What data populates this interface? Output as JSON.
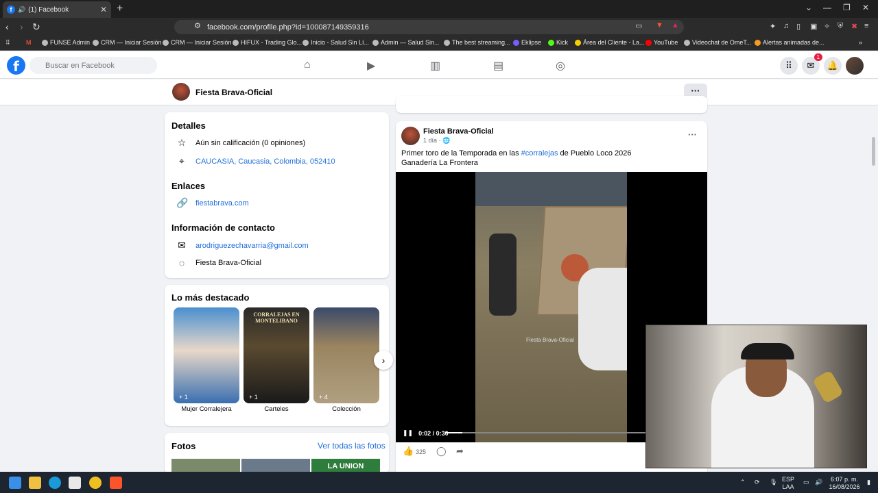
{
  "browser": {
    "tab_title": "(1) Facebook",
    "url": "facebook.com/profile.php?id=100087149359316",
    "bookmarks": [
      "FUNSE Admin",
      "CRM — Iniciar Sesión",
      "CRM — Iniciar Sesión",
      "HIFUX - Trading Glo...",
      "Inicio - Salud Sin Lí...",
      "Admin — Salud Sin...",
      "The best streaming...",
      "Eklipse",
      "Kick",
      "Área del Cliente - La...",
      "YouTube",
      "Videochat de OmeT...",
      "Alertas animadas de..."
    ]
  },
  "facebook": {
    "search_placeholder": "Buscar en Facebook",
    "messenger_badge": "1"
  },
  "page": {
    "name": "Fiesta Brava-Oficial"
  },
  "details": {
    "title": "Detalles",
    "rating": "Aún sin calificación (0 opiniones)",
    "location": "CAUCASIA, Caucasia, Colombia, 052410"
  },
  "links": {
    "title": "Enlaces",
    "website": "fiestabrava.com"
  },
  "contact": {
    "title": "Información de contacto",
    "email": "arodriguezechavarria@gmail.com",
    "messenger": "Fiesta Brava-Oficial"
  },
  "highlights": {
    "title": "Lo más destacado",
    "items": [
      {
        "caption": "Mujer Corralejera",
        "count": "+ 1",
        "color": "#4a8fd0"
      },
      {
        "caption": "Carteles",
        "count": "+ 1",
        "color": "#5a4a30"
      },
      {
        "caption": "Colección",
        "count": "+ 4",
        "color": "#9a8460"
      }
    ],
    "poster_text": "CORRALEJAS EN MONTELIBANO"
  },
  "photos": {
    "title": "Fotos",
    "see_all": "Ver todas las fotos",
    "thumb_text": "LA UNION"
  },
  "post": {
    "author": "Fiesta Brava-Oficial",
    "time": "1 día · ",
    "text_before": "Primer toro de la Temporada en las ",
    "hashtag": "#corralejas",
    "text_after": " de Pueblo Loco 2026",
    "line2": "Ganadería La Frontera",
    "video_watermark": "Fiesta Brava-Oficial",
    "video_time": "0:02 / 0:30",
    "progress": 0.067,
    "likes": "325"
  },
  "taskbar": {
    "lang": "ESP",
    "lang2": "LAA",
    "time": "6:07 p. m.",
    "date": "16/08/2026"
  },
  "colors": {
    "fb_blue": "#1877f2",
    "link_blue": "#216fdb"
  }
}
